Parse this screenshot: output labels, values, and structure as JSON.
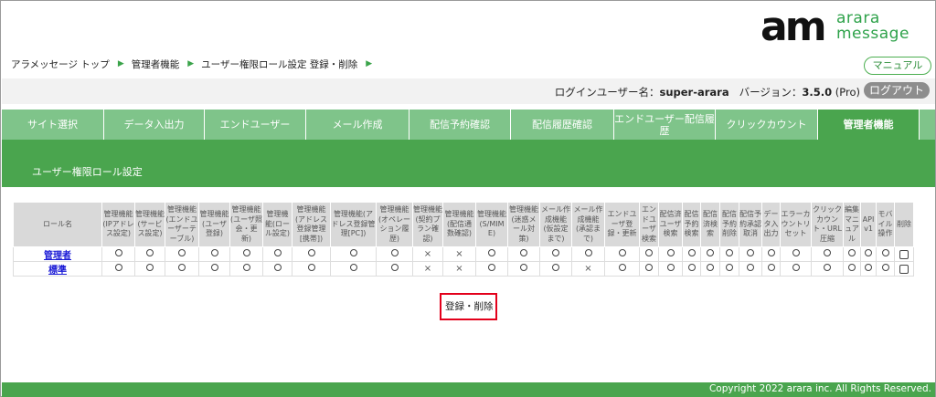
{
  "logo": {
    "mark": "am",
    "line1": "arara",
    "line2": "message"
  },
  "breadcrumb": [
    "アラメッセージ トップ",
    "管理者機能",
    "ユーザー権限ロール設定 登録・削除"
  ],
  "header": {
    "manual_label": "マニュアル",
    "logout_label": "ログアウト"
  },
  "userbar": {
    "user_prefix": "ログインユーザー名：",
    "username": "super-arara",
    "version_prefix": "バージョン：",
    "version": "3.5.0",
    "edition": "(Pro)"
  },
  "tabs": [
    {
      "label": "サイト選択",
      "active": false
    },
    {
      "label": "データ入出力",
      "active": false
    },
    {
      "label": "エンドユーザー",
      "active": false
    },
    {
      "label": "メール作成",
      "active": false
    },
    {
      "label": "配信予約確認",
      "active": false
    },
    {
      "label": "配信履歴確認",
      "active": false
    },
    {
      "label": "エンドユーザー配信履歴",
      "active": false
    },
    {
      "label": "クリックカウント",
      "active": false
    },
    {
      "label": "管理者機能",
      "active": true
    }
  ],
  "band": {
    "title": "ユーザー権限ロール設定"
  },
  "table": {
    "columns": [
      "ロール名",
      "管理機能(IPアドレス設定)",
      "管理機能(サービス設定)",
      "管理機能(エンドユーザーテーブル)",
      "管理機能(ユーザ登録)",
      "管理機能(ユーザ照会・更新)",
      "管理機能(ロール設定)",
      "管理機能(アドレス登録管理[携帯])",
      "管理機能(アドレス登録管理[PC])",
      "管理機能(オペレーション履歴)",
      "管理機能(契約プラン確認)",
      "管理機能(配信通数確認)",
      "管理機能(S/MIME)",
      "管理機能(迷惑メール対策)",
      "メール作成機能(仮設定まで)",
      "メール作成機能(承認まで)",
      "エンドユーザ登録・更新",
      "エンドユーザ検索",
      "配信済ユーザ検索",
      "配信予約検索",
      "配信済検索",
      "配信予約削除",
      "配信予約承認取消",
      "データ入出力",
      "エラーカウントリセット",
      "クリックカウント・URL圧縮",
      "編集マニュアル",
      "API v1",
      "モバイル操作",
      "削除"
    ],
    "rows": [
      {
        "role": "管理者",
        "marks": [
          "o",
          "o",
          "o",
          "o",
          "o",
          "o",
          "o",
          "o",
          "o",
          "x",
          "x",
          "o",
          "o",
          "o",
          "o",
          "o",
          "o",
          "o",
          "o",
          "o",
          "o",
          "o",
          "o",
          "o",
          "o",
          "o",
          "o",
          "o"
        ]
      },
      {
        "role": "標準",
        "marks": [
          "o",
          "o",
          "o",
          "o",
          "o",
          "o",
          "o",
          "o",
          "o",
          "x",
          "x",
          "o",
          "o",
          "o",
          "x",
          "o",
          "o",
          "o",
          "o",
          "o",
          "o",
          "o",
          "o",
          "o",
          "o",
          "o",
          "o",
          "o"
        ]
      }
    ]
  },
  "submit": {
    "label": "登録・削除"
  },
  "footer": {
    "copyright": "Copyright 2022 arara inc. All Rights Reserved."
  }
}
